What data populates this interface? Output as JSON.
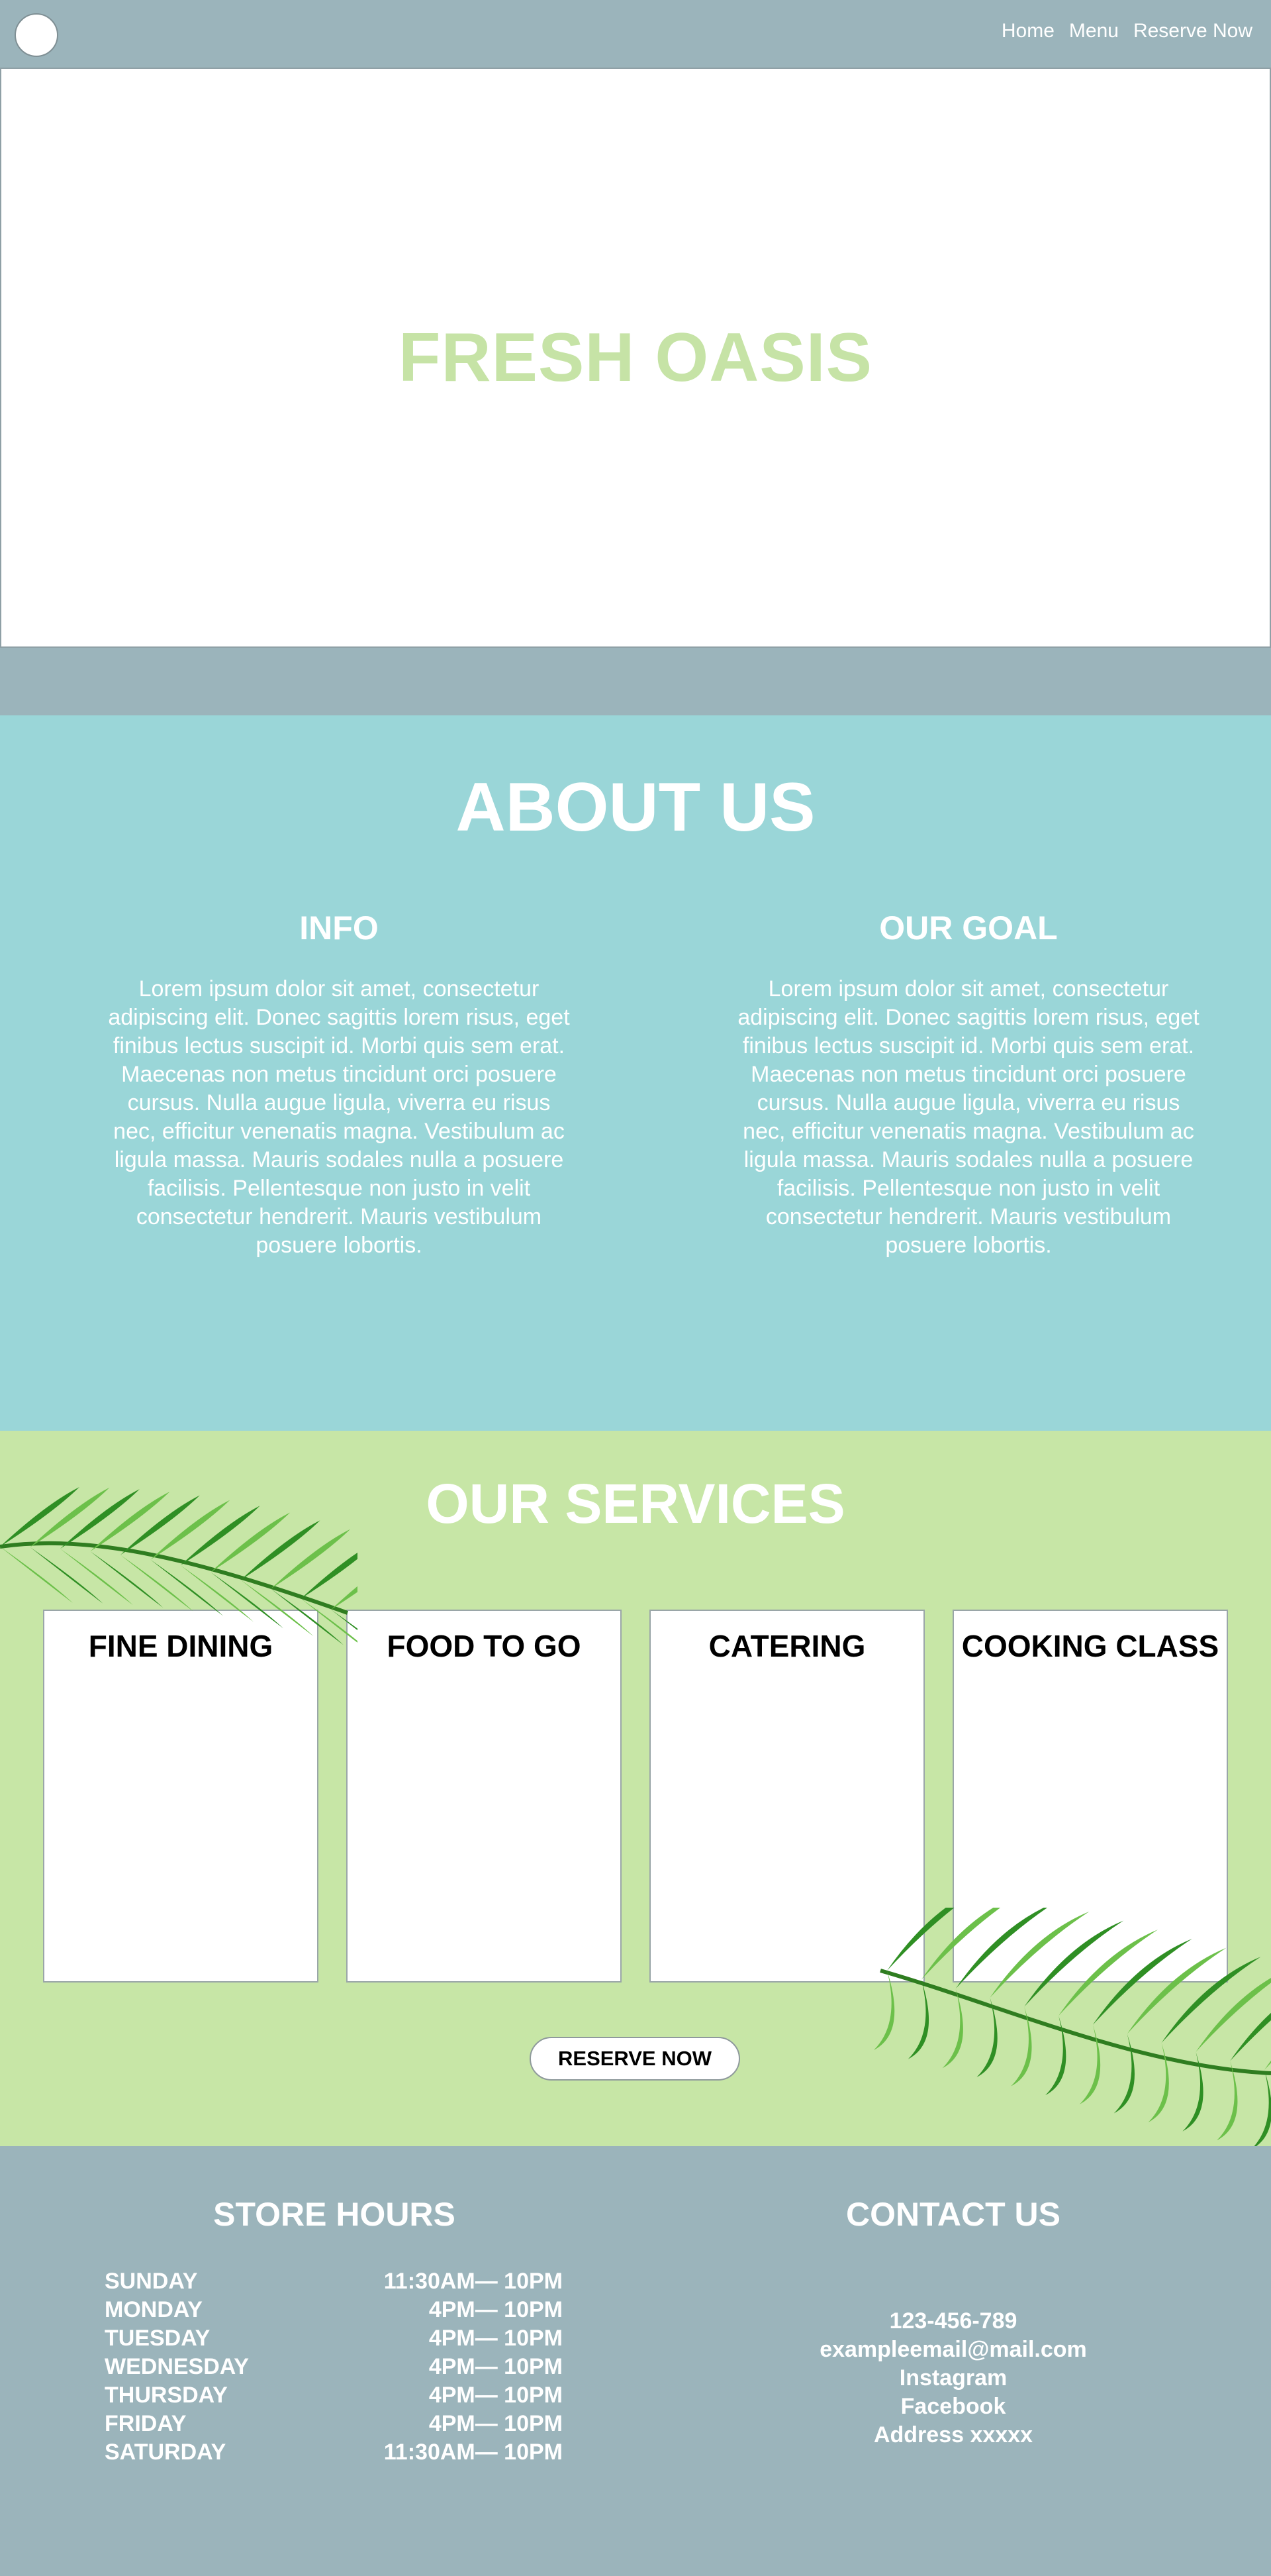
{
  "nav": {
    "links": [
      "Home",
      "Menu",
      "Reserve Now"
    ]
  },
  "hero": {
    "title": "FRESH OASIS"
  },
  "about": {
    "title": "ABOUT US",
    "columns": [
      {
        "heading": "INFO",
        "text": "Lorem ipsum dolor sit amet, consectetur adipiscing elit. Donec sagittis lorem risus, eget finibus lectus suscipit id. Morbi quis sem erat. Maecenas non metus tincidunt orci posuere cursus. Nulla augue ligula, viverra eu risus nec, efficitur venenatis magna. Vestibulum ac ligula massa. Mauris sodales nulla a posuere facilisis. Pellentesque non justo in velit consectetur hendrerit. Mauris vestibulum posuere lobortis."
      },
      {
        "heading": "OUR GOAL",
        "text": "Lorem ipsum dolor sit amet, consectetur adipiscing elit. Donec sagittis lorem risus, eget finibus lectus suscipit id. Morbi quis sem erat. Maecenas non metus tincidunt orci posuere cursus. Nulla augue ligula, viverra eu risus nec, efficitur venenatis magna. Vestibulum ac ligula massa. Mauris sodales nulla a posuere facilisis. Pellentesque non justo in velit consectetur hendrerit. Mauris vestibulum posuere lobortis."
      }
    ]
  },
  "services": {
    "title": "OUR SERVICES",
    "cards": [
      "FINE DINING",
      "FOOD TO GO",
      "CATERING",
      "COOKING CLASS"
    ],
    "reserve_label": "RESERVE NOW"
  },
  "hours": {
    "title": "STORE HOURS",
    "rows": [
      {
        "day": "SUNDAY",
        "time": "11:30AM— 10PM"
      },
      {
        "day": "MONDAY",
        "time": "4PM— 10PM"
      },
      {
        "day": "TUESDAY",
        "time": "4PM— 10PM"
      },
      {
        "day": "WEDNESDAY",
        "time": "4PM— 10PM"
      },
      {
        "day": "THURSDAY",
        "time": "4PM— 10PM"
      },
      {
        "day": "FRIDAY",
        "time": "4PM— 10PM"
      },
      {
        "day": "SATURDAY",
        "time": "11:30AM— 10PM"
      }
    ]
  },
  "contact": {
    "title": "CONTACT US",
    "lines": [
      "123-456-789",
      "exampleemail@mail.com",
      "Instagram",
      "Facebook",
      "Address xxxxx"
    ]
  },
  "colors": {
    "nav_bg": "#9bb4bb",
    "hero_title": "#c6e3a6",
    "about_bg": "#9ad6d8",
    "services_bg": "#c7e6a6",
    "leaf_dark": "#2f8f24",
    "leaf_light": "#6cc04a"
  }
}
